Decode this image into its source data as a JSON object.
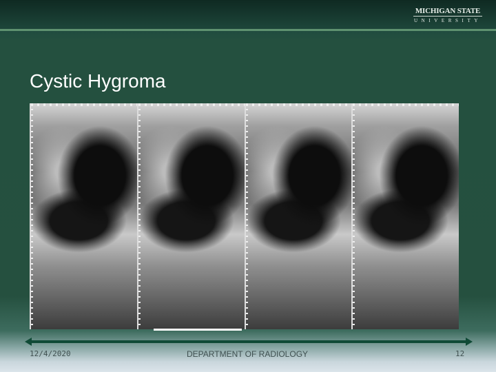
{
  "header": {
    "logo_line1": "MICHIGAN STATE",
    "logo_line2": "UNIVERSITY"
  },
  "slide": {
    "title": "Cystic Hygroma",
    "image_panel_count": 4
  },
  "footer": {
    "date": "12/4/2020",
    "department": "DEPARTMENT OF RADIOLOGY",
    "page_number": "12"
  },
  "colors": {
    "background": "#25503f",
    "accent_rule": "#0f4a36",
    "title": "#ffffff"
  }
}
